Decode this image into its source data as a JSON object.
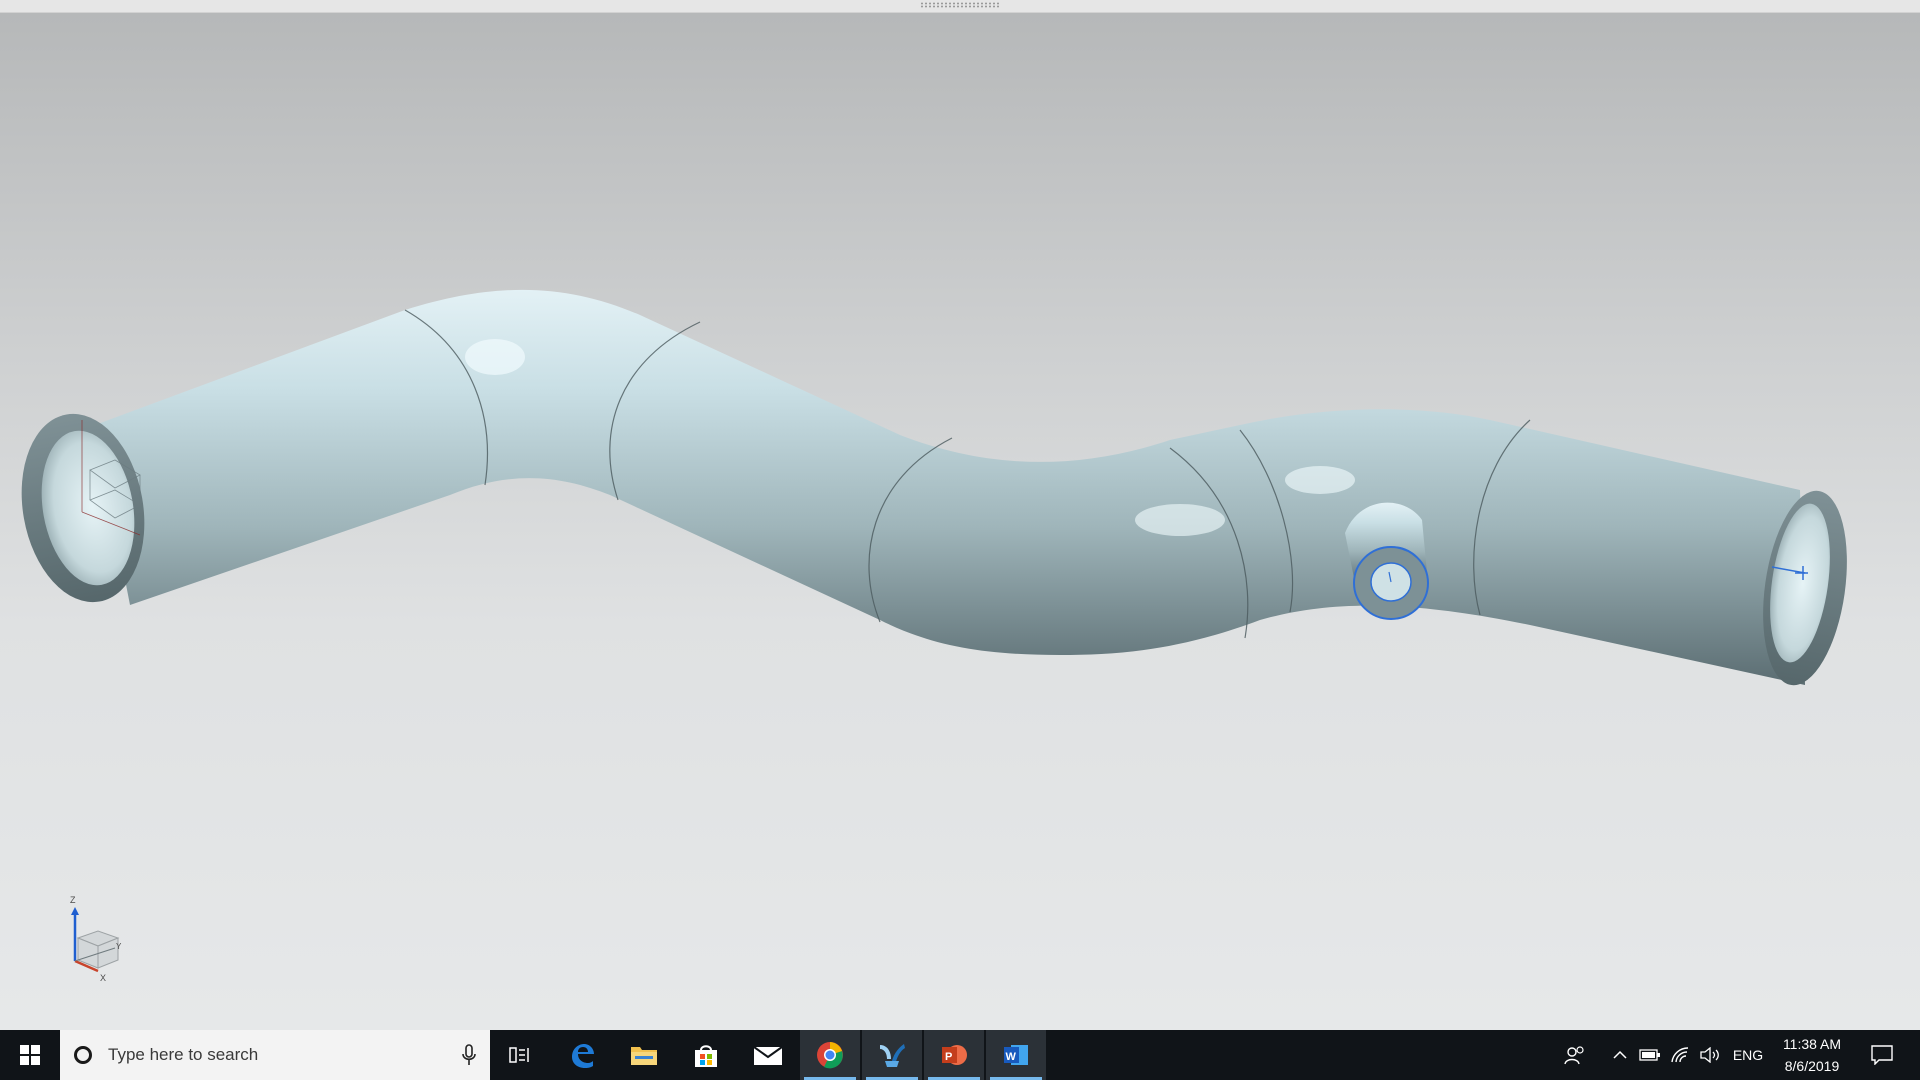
{
  "viewport": {
    "model": "Pipe assembly with elbow bends and side branch",
    "triad_axes": {
      "z": "Z",
      "y": "Y",
      "x": "X"
    }
  },
  "taskbar": {
    "search": {
      "placeholder": "Type here to search"
    },
    "apps": [
      {
        "name": "Task View",
        "icon": "task-view-icon",
        "active": false
      },
      {
        "name": "Microsoft Edge",
        "icon": "edge-icon",
        "active": false
      },
      {
        "name": "File Explorer",
        "icon": "folder-icon",
        "active": false
      },
      {
        "name": "Microsoft Store",
        "icon": "store-icon",
        "active": false
      },
      {
        "name": "Mail",
        "icon": "mail-icon",
        "active": false
      },
      {
        "name": "Google Chrome",
        "icon": "chrome-icon",
        "active": true
      },
      {
        "name": "CAD application",
        "icon": "cad-app-icon",
        "active": true
      },
      {
        "name": "PowerPoint",
        "icon": "powerpoint-icon",
        "active": true
      },
      {
        "name": "Word",
        "icon": "word-icon",
        "active": true
      }
    ],
    "tray": {
      "language": "ENG",
      "time": "11:38 AM",
      "date": "8/6/2019"
    }
  },
  "colors": {
    "taskbar": "#101418",
    "accent_underline": "#76b9ed",
    "pipe_light": "#dbeef3",
    "pipe_dark": "#5f7277",
    "selection_blue": "#2f6fd6"
  }
}
